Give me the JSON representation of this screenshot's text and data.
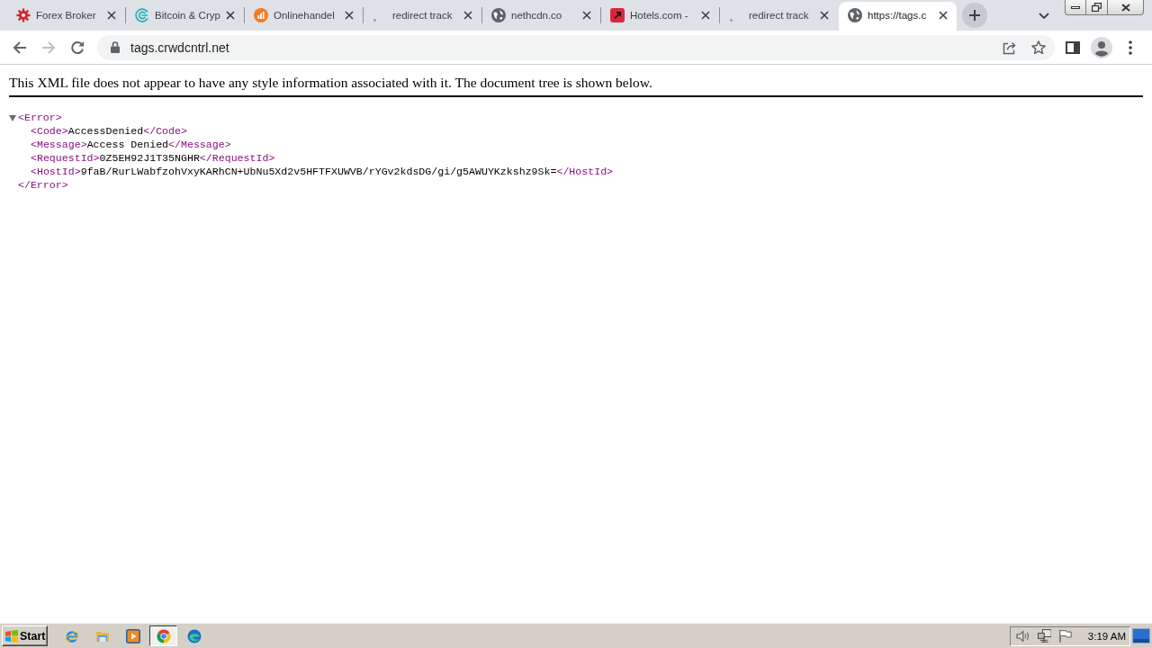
{
  "tabs": [
    {
      "title": "Forex Broker",
      "selected": false
    },
    {
      "title": "Bitcoin & Cryp",
      "selected": false
    },
    {
      "title": "Onlinehandel",
      "selected": false
    },
    {
      "title": "redirect track",
      "selected": false
    },
    {
      "title": "nethcdn.co",
      "selected": false
    },
    {
      "title": "Hotels.com -",
      "selected": false
    },
    {
      "title": "redirect track",
      "selected": false
    },
    {
      "title": "https://tags.c",
      "selected": true
    }
  ],
  "toolbar": {
    "back": {
      "disabled": false
    },
    "forward": {
      "disabled": true
    },
    "url": "tags.crwdcntrl.net"
  },
  "page": {
    "notice": "This XML file does not appear to have any style information associated with it. The document tree is shown below.",
    "xml": {
      "open_tag": "<Error>",
      "expanded": true,
      "children": [
        {
          "open_tag": "<Code>",
          "text": "AccessDenied",
          "close_tag": "</Code>"
        },
        {
          "open_tag": "<Message>",
          "text": "Access Denied",
          "close_tag": "</Message>"
        },
        {
          "open_tag": "<RequestId>",
          "text": "0Z5EH92J1T35NGHR",
          "close_tag": "</RequestId>"
        },
        {
          "open_tag": "<HostId>",
          "text": "9faB/RurLWabfzohVxyKARhCN+UbNu5Xd2v5HFTFXUWVB/rYGv2kdsDG/gi/g5AWUYKzkshz9Sk=",
          "close_tag": "</HostId>"
        }
      ],
      "close_tag": "</Error>"
    }
  },
  "taskbar": {
    "start": "Start",
    "items": [
      {
        "selected": false
      },
      {
        "selected": false
      },
      {
        "selected": false
      },
      {
        "selected": true
      },
      {
        "selected": false
      }
    ],
    "clock": "3:19 AM"
  }
}
